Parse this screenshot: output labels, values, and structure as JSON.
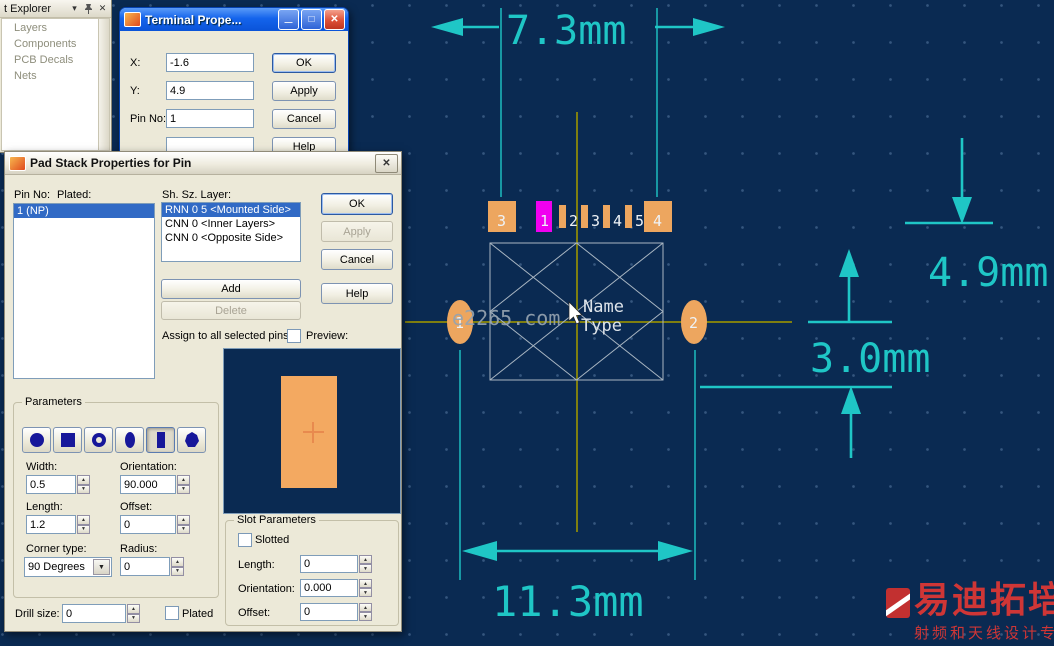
{
  "explorer": {
    "title": "t Explorer",
    "items": [
      "Layers",
      "Components",
      "PCB Decals",
      "Nets"
    ]
  },
  "terminal_dialog": {
    "title": "Terminal Prope...",
    "x_label": "X:",
    "x_value": "-1.6",
    "y_label": "Y:",
    "y_value": "4.9",
    "pin_label": "Pin No:",
    "pin_value": "1",
    "ok": "OK",
    "apply": "Apply",
    "cancel": "Cancel",
    "help": "Help"
  },
  "padstack_dialog": {
    "title": "Pad Stack Properties for Pin",
    "pin_no_label": "Pin No:",
    "plated_label": "Plated:",
    "layer_header": "Sh. Sz. Layer:",
    "pin_items": [
      "1 (NP)"
    ],
    "layers": [
      "RNN 0 5 <Mounted Side>",
      "CNN 0 <Inner Layers>",
      "CNN 0 <Opposite Side>"
    ],
    "ok": "OK",
    "apply": "Apply",
    "cancel": "Cancel",
    "add": "Add",
    "delete": "Delete",
    "help": "Help",
    "assign_label": "Assign to all selected pins",
    "preview_label": "Preview:",
    "shapes": [
      "circle",
      "square",
      "donut",
      "oval",
      "rectangle",
      "odd"
    ],
    "params": {
      "title": "Parameters",
      "width_label": "Width:",
      "width": "0.5",
      "orientation_label": "Orientation:",
      "orientation": "90.000",
      "length_label": "Length:",
      "length": "1.2",
      "offset_label": "Offset:",
      "offset": "0",
      "corner_label": "Corner type:",
      "corner": "90 Degrees",
      "radius_label": "Radius:",
      "radius": "0"
    },
    "drill_label": "Drill size:",
    "drill": "0",
    "plated_check": "Plated",
    "slot": {
      "title": "Slot Parameters",
      "slotted": "Slotted",
      "length_label": "Length:",
      "length": "0",
      "orientation_label": "Orientation:",
      "orientation": "0.000",
      "offset_label": "Offset:",
      "offset": "0"
    }
  },
  "canvas": {
    "dim_top": "7.3mm",
    "dim_right": "4.9mm",
    "dim_mid": "3.0mm",
    "dim_bottom": "11.3mm",
    "name_text": "Name",
    "type_text": "Type",
    "pads": {
      "p3": "3",
      "p4": "4",
      "left": "1",
      "right": "2",
      "pins": [
        "1",
        "2",
        "3",
        "4",
        "5"
      ]
    },
    "watermark": "e2265.com",
    "brand_title": "易迪拓培训",
    "brand_sub": "射频和天线设计专家",
    "colors": {
      "bg": "#0a2a52",
      "dimension": "#1fc6c6",
      "pad": "#eda65f",
      "selected_pad": "#f000f0",
      "crosshair": "#7f7f10"
    }
  }
}
